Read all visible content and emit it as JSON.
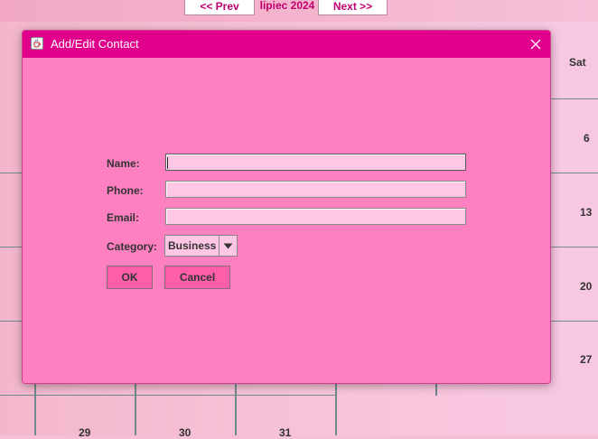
{
  "calendar": {
    "prev_label": "<< Prev",
    "next_label": "Next >>",
    "month_label": "lipiec 2024",
    "sat_header": "Sat",
    "side_days": [
      "6",
      "13",
      "20",
      "27"
    ],
    "bottom_days": [
      "29",
      "30",
      "31"
    ]
  },
  "dialog": {
    "title": "Add/Edit Contact",
    "fields": {
      "name_label": "Name:",
      "name_value": "",
      "phone_label": "Phone:",
      "phone_value": "",
      "email_label": "Email:",
      "email_value": "",
      "category_label": "Category:",
      "category_value": "Business"
    },
    "buttons": {
      "ok_label": "OK",
      "cancel_label": "Cancel"
    }
  },
  "icons": {
    "app": "java-cup-icon",
    "close": "close-icon",
    "dropdown": "chevron-down-icon"
  },
  "colors": {
    "titlebar": "#e0008c",
    "dialog_bg": "#ff80c0",
    "field_bg": "#ffc7e3",
    "button_bg": "#ff5fa8",
    "accent_text": "#c0006f"
  }
}
